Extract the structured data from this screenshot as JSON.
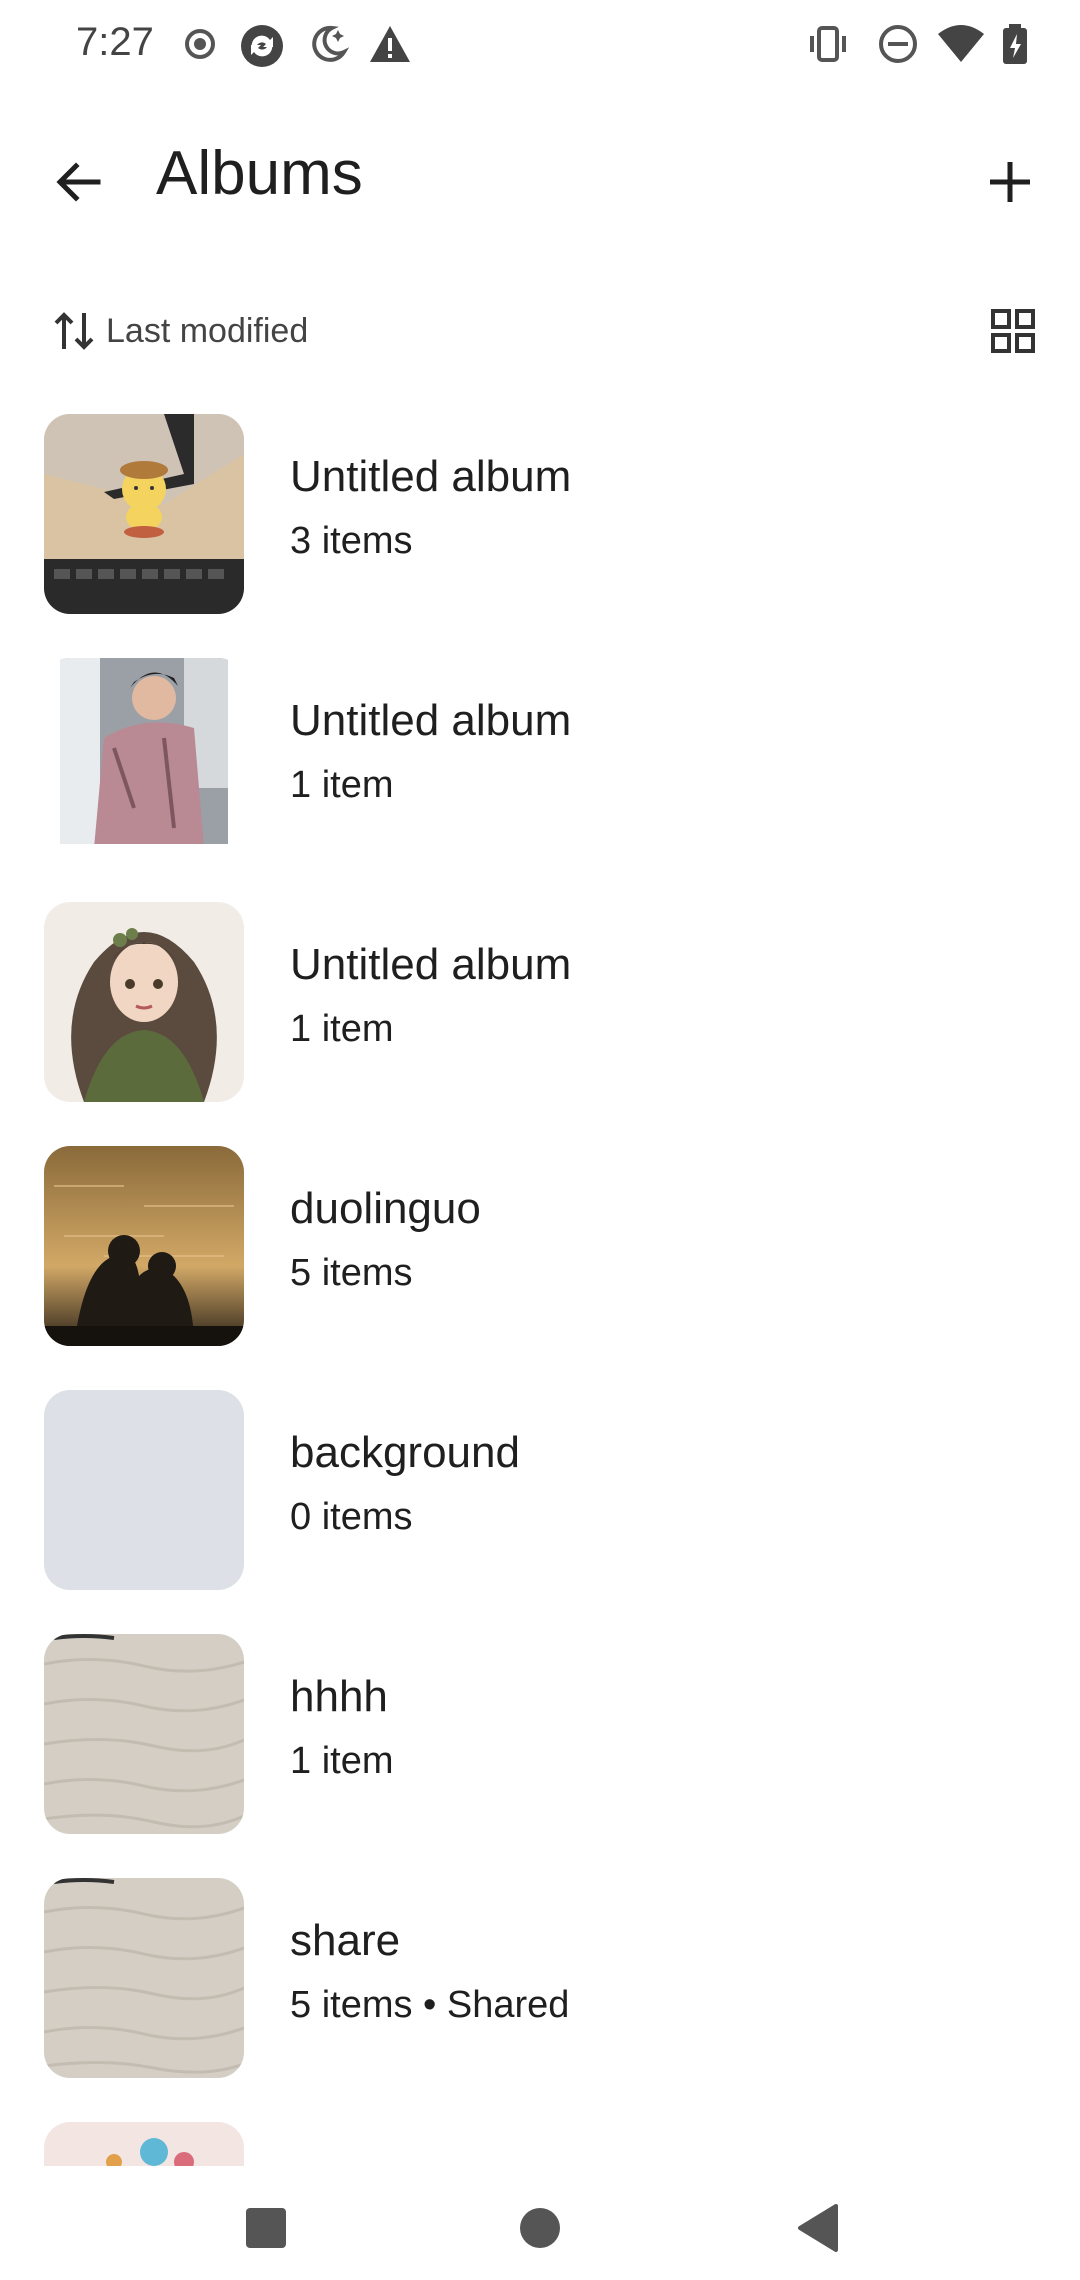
{
  "status_bar": {
    "time": "7:27",
    "left_icons": [
      "record-icon",
      "sync-icon",
      "night-mode-icon",
      "alert-icon"
    ],
    "right_icons": [
      "vibrate-icon",
      "do-not-disturb-icon",
      "wifi-icon",
      "battery-charging-icon"
    ]
  },
  "app_bar": {
    "title": "Albums",
    "back_icon": "arrow-back-icon",
    "add_icon": "plus-icon"
  },
  "sort": {
    "label": "Last modified",
    "icon": "sort-arrows-icon",
    "view_toggle_icon": "grid-view-icon"
  },
  "albums": [
    {
      "name": "Untitled album",
      "count": "3 items"
    },
    {
      "name": "Untitled album",
      "count": "1 item"
    },
    {
      "name": "Untitled album",
      "count": "1 item"
    },
    {
      "name": "duolinguo",
      "count": "5 items"
    },
    {
      "name": "background",
      "count": "0 items"
    },
    {
      "name": "hhhh",
      "count": "1 item"
    },
    {
      "name": "share",
      "count": "5 items • Shared"
    }
  ],
  "nav_bar": {
    "recents_icon": "square-icon",
    "home_icon": "circle-icon",
    "back_icon": "triangle-back-icon"
  },
  "colors": {
    "background": "#ffffff",
    "text_primary": "#1f1f1f",
    "text_secondary": "#444444",
    "empty_thumb": "#dde1e7"
  }
}
